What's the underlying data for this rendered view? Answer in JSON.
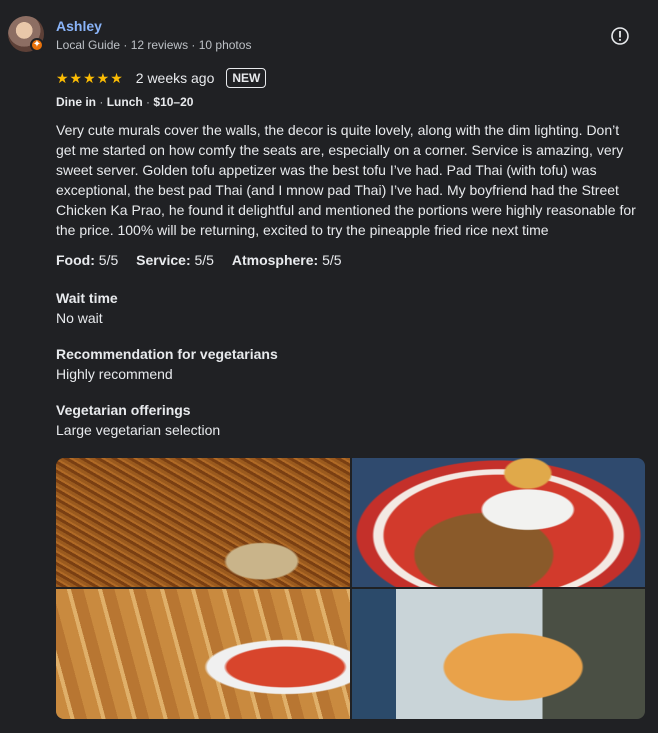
{
  "reviewer": {
    "name": "Ashley",
    "meta": "Local Guide · 12 reviews · 10 photos",
    "badge_icon": "local-guide-star-icon"
  },
  "report_icon": "report-icon",
  "rating": {
    "stars": "★★★★★",
    "value": 5,
    "max": 5,
    "when": "2 weeks ago",
    "new_label": "NEW"
  },
  "tags": {
    "dine": "Dine in",
    "meal": "Lunch",
    "price": "$10–20"
  },
  "review_text": "Very cute murals cover the walls, the decor is quite lovely, along with the dim lighting. Don’t get me started on how comfy the seats are, especially on a corner. Service is amazing, very sweet server. Golden tofu appetizer was the best tofu I’ve had. Pad Thai (with tofu) was exceptional, the best pad Thai (and I mnow pad Thai) I’ve had. My boyfriend had the Street Chicken Ka Prao, he found it delightful and mentioned the portions were highly reasonable for the price. 100% will be returning, excited to try the pineapple fried rice next time",
  "scores": [
    {
      "label": "Food:",
      "value": "5/5"
    },
    {
      "label": "Service:",
      "value": "5/5"
    },
    {
      "label": "Atmosphere:",
      "value": "5/5"
    }
  ],
  "sections": [
    {
      "heading": "Wait time",
      "value": "No wait"
    },
    {
      "heading": "Recommendation for vegetarians",
      "value": "Highly recommend"
    },
    {
      "heading": "Vegetarian offerings",
      "value": "Large vegetarian selection"
    }
  ],
  "photos": [
    "pad-thai-photo",
    "ka-prao-photo",
    "golden-tofu-photo",
    "iced-drink-photo"
  ],
  "colors": {
    "background": "#202124",
    "name": "#8ab4f8",
    "stars": "#fbbc04",
    "guide_badge": "#e8710a"
  }
}
